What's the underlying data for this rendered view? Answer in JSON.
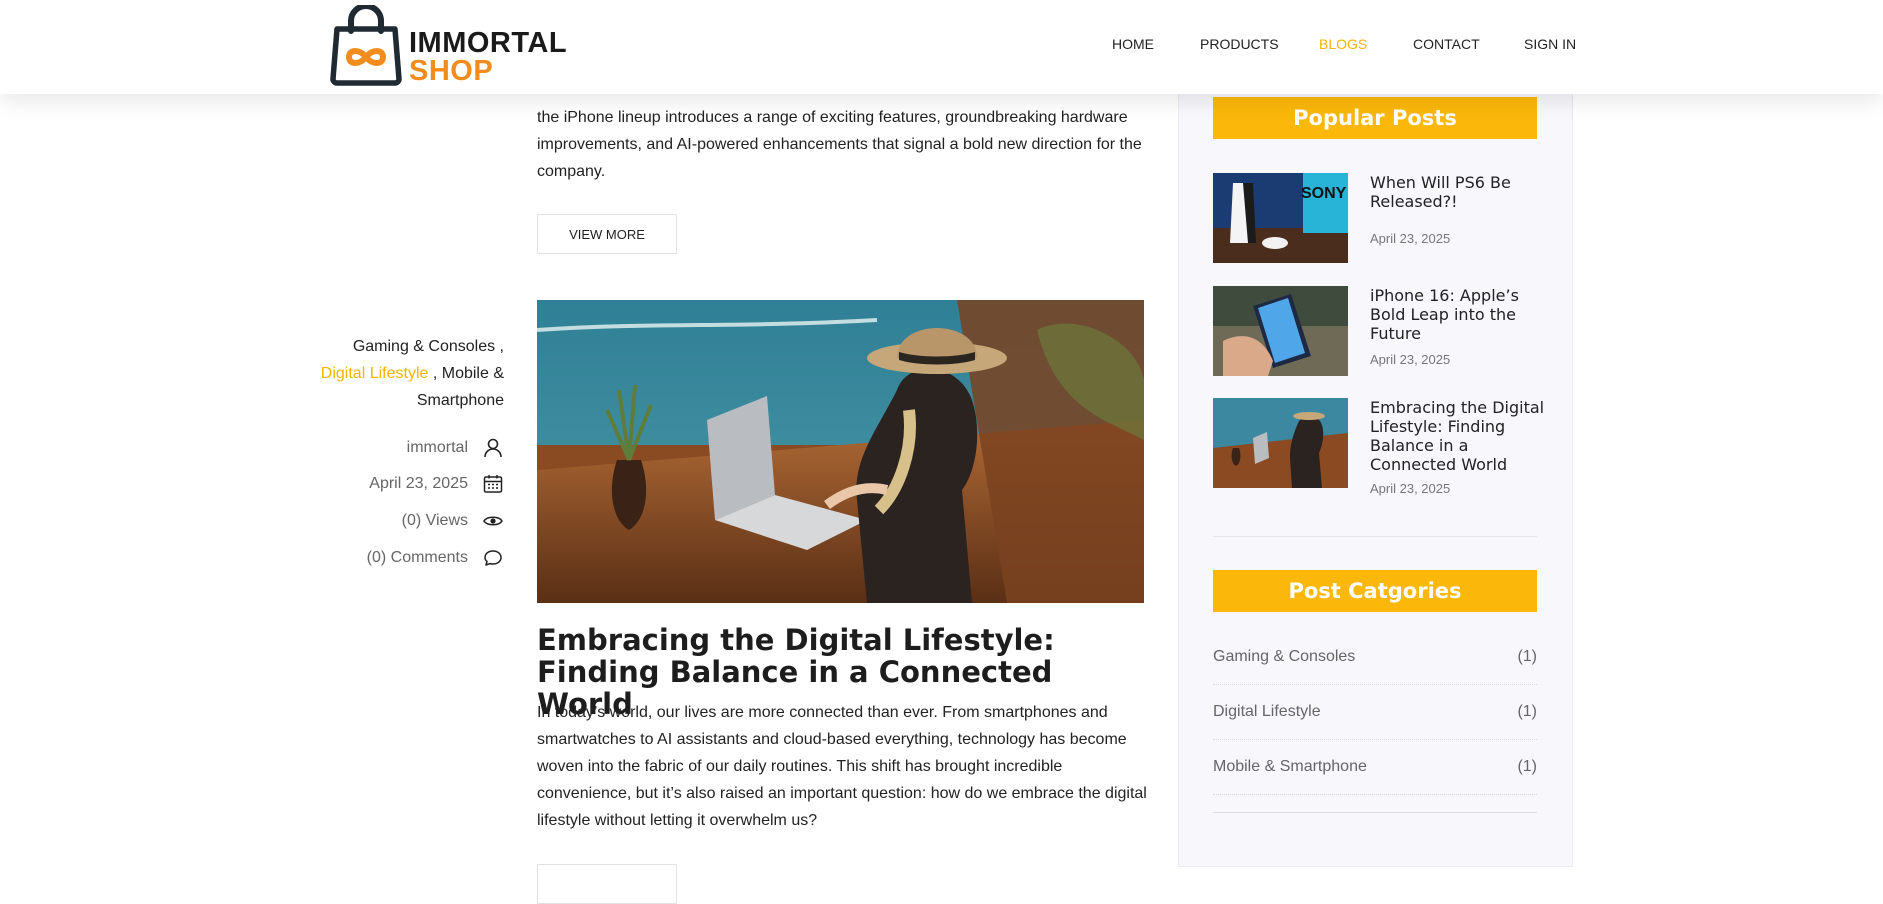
{
  "brand": {
    "line1": "IMMORTAL",
    "line2": "SHOP"
  },
  "nav": {
    "home": "HOME",
    "products": "PRODUCTS",
    "blogs": "BLOGS",
    "contact": "CONTACT",
    "signin": "SIGN IN"
  },
  "post1": {
    "excerpt": "the iPhone lineup introduces a range of exciting features, groundbreaking hardware improvements, and AI-powered enhancements that signal a bold new direction for the company.",
    "view_more": "VIEW MORE"
  },
  "post2": {
    "categories": {
      "c1": "Gaming & Consoles",
      "c2": "Digital Lifestyle",
      "c3": "Mobile & Smartphone"
    },
    "author": "immortal",
    "date": "April 23, 2025",
    "views": "(0) Views",
    "comments": "(0) Comments",
    "title": "Embracing the Digital Lifestyle: Finding Balance in a Connected World",
    "excerpt": "In today’s world, our lives are more connected than ever. From smartphones and smartwatches to AI assistants and cloud-based everything, technology has become woven into the fabric of our daily routines. This shift has brought incredible convenience, but it’s also raised an important question: how do we embrace the digital lifestyle without letting it overwhelm us?"
  },
  "sidebar": {
    "popular_title": "Popular Posts",
    "popular": [
      {
        "title": "When Will PS6 Be Released?!",
        "date": "April 23, 2025"
      },
      {
        "title": "iPhone 16: Apple’s Bold Leap into the Future",
        "date": "April 23, 2025"
      },
      {
        "title": "Embracing the Digital Lifestyle: Finding Balance in a Connected World",
        "date": "April 23, 2025"
      }
    ],
    "categories_title": "Post Catgories",
    "categories": [
      {
        "name": "Gaming & Consoles",
        "count": "(1)"
      },
      {
        "name": "Digital Lifestyle",
        "count": "(1)"
      },
      {
        "name": "Mobile & Smartphone",
        "count": "(1)"
      }
    ]
  },
  "colors": {
    "accent": "#fbb80a",
    "brand_orange": "#f28c1c",
    "text": "#222222",
    "muted": "#666666"
  }
}
